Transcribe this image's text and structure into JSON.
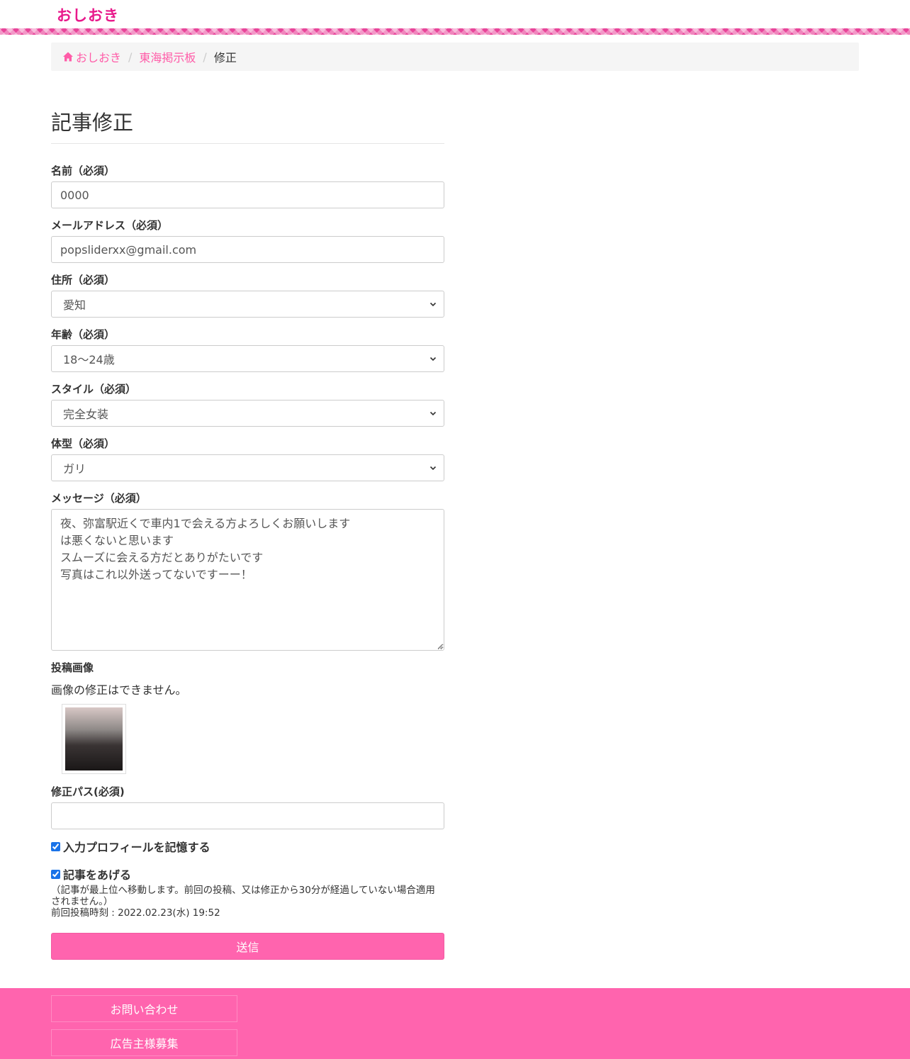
{
  "header": {
    "logo": "おしおき"
  },
  "breadcrumb": {
    "home": "おしおき",
    "board": "東海掲示板",
    "current": "修正"
  },
  "page_title": "記事修正",
  "form": {
    "name": {
      "label": "名前（必須）",
      "value": "0000"
    },
    "email": {
      "label": "メールアドレス（必須）",
      "value": "popsliderxx@gmail.com"
    },
    "address": {
      "label": "住所（必須）",
      "selected": "愛知"
    },
    "age": {
      "label": "年齢（必須）",
      "selected": "18〜24歳"
    },
    "style": {
      "label": "スタイル（必須）",
      "selected": "完全女装"
    },
    "body_type": {
      "label": "体型（必須）",
      "selected": "ガリ"
    },
    "message": {
      "label": "メッセージ（必須）",
      "value": "夜、弥富駅近くで車内1で会える方よろしくお願いします\nは悪くないと思います\nスムーズに会える方だとありがたいです\n写真はこれ以外送ってないですーー！"
    },
    "image": {
      "label": "投稿画像",
      "note": "画像の修正はできません。"
    },
    "password": {
      "label": "修正パス(必須)",
      "value": ""
    },
    "remember_profile": {
      "label": "入力プロフィールを記憶する",
      "checked": true
    },
    "bump": {
      "label": "記事をあげる",
      "checked": true,
      "note": "（記事が最上位へ移動します。前回の投稿、又は修正から30分が経過していない場合適用されません。）",
      "last_post": "前回投稿時刻 : 2022.02.23(水) 19:52"
    },
    "submit_label": "送信"
  },
  "footer": {
    "contact": "お問い合わせ",
    "advertise": "広告主様募集"
  },
  "colors": {
    "brand": "#e8198b",
    "accent": "#ff64ae",
    "link": "#ff5ca8"
  }
}
